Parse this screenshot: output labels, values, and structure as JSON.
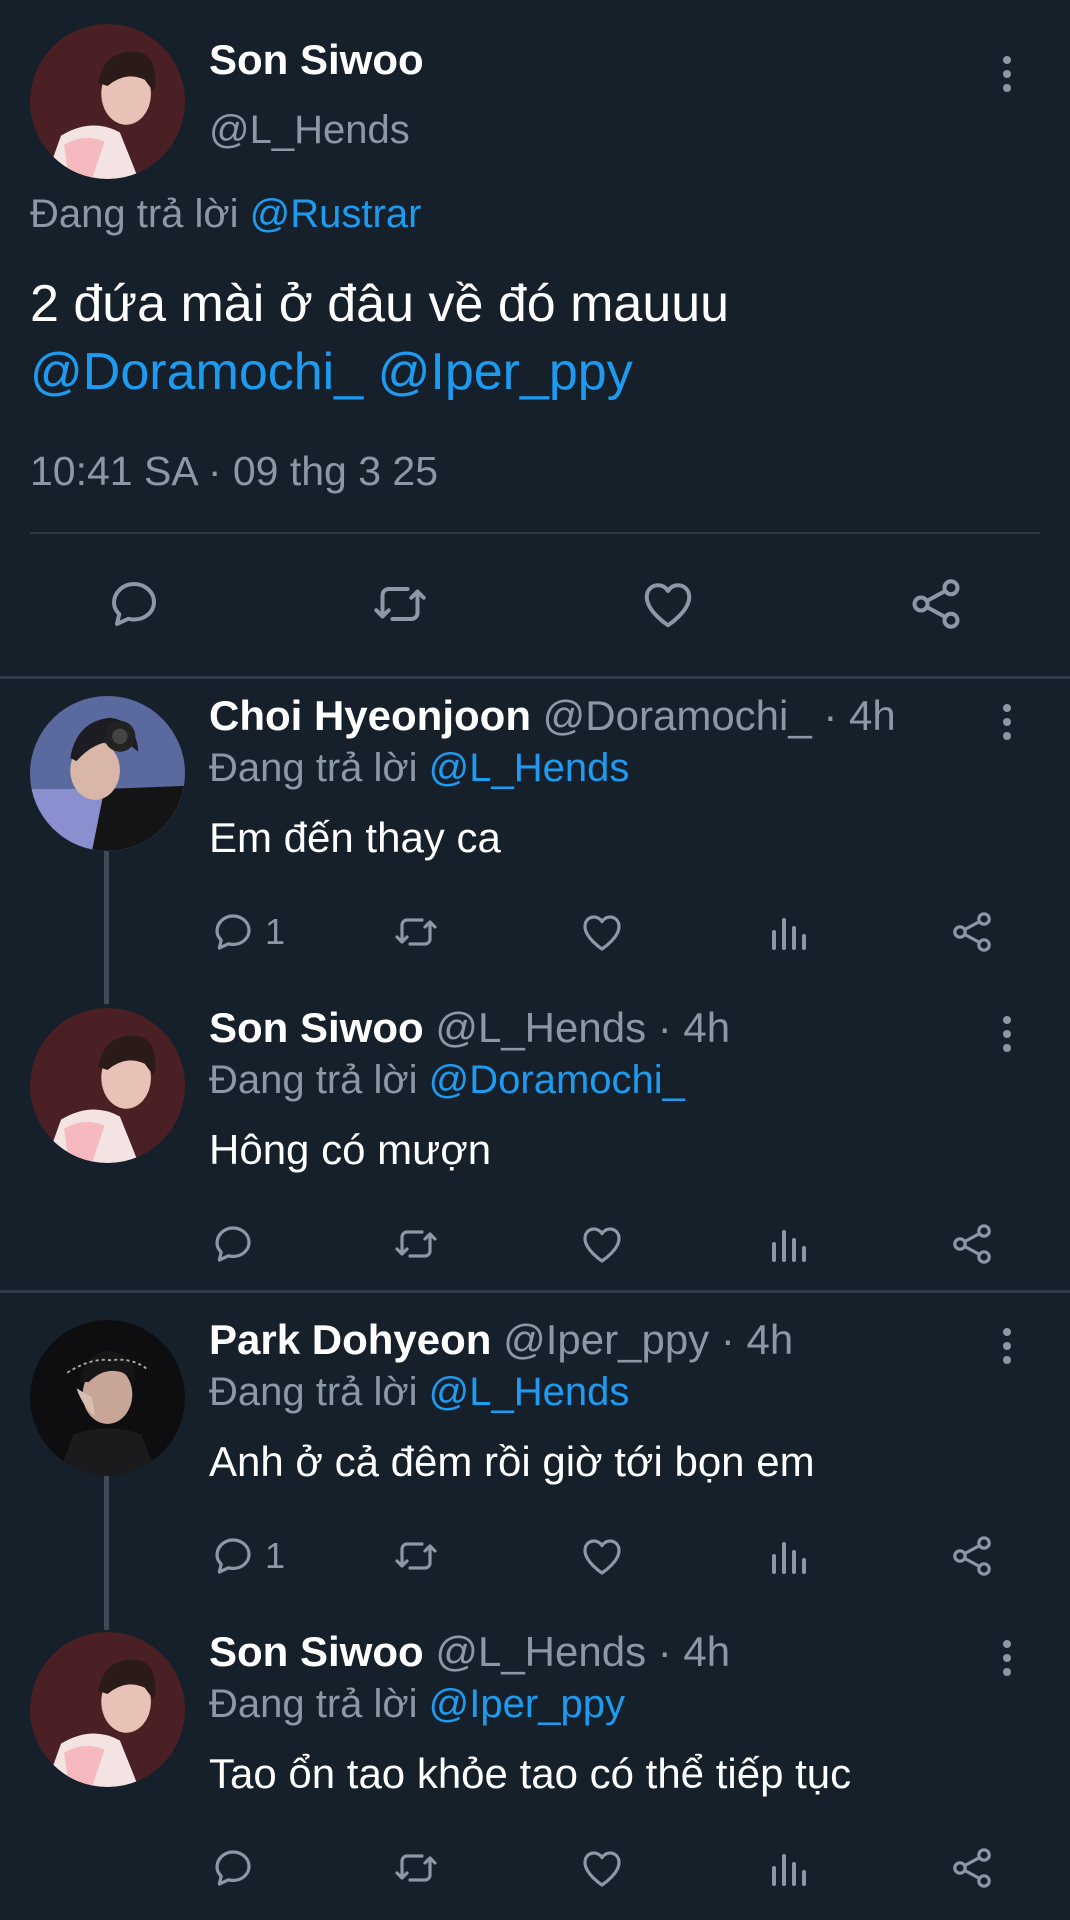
{
  "main_tweet": {
    "author_name": "Son Siwoo",
    "author_handle": "@L_Hends",
    "replying_prefix": "Đang trả lời",
    "replying_to": "@Rustrar",
    "text_line1": "2 đứa mài ở đâu về đó mauuu",
    "mention1": "@Doramochi_",
    "mention2": "@Iper_ppy",
    "timestamp": "10:41 SA · 09 thg 3 25",
    "icons": [
      "reply-icon",
      "retweet-icon",
      "like-icon",
      "share-icon"
    ]
  },
  "replies": [
    {
      "name": "Choi Hyeonjoon",
      "handle_time": "@Doramochi_ · 4h",
      "replying_prefix": "Đang trả lời",
      "replying_to": "@L_Hends",
      "text": "Em đến thay ca",
      "reply_count": "1",
      "avatar": "dark-avatar-headset"
    },
    {
      "name": "Son Siwoo",
      "handle_time": "@L_Hends · 4h",
      "replying_prefix": "Đang trả lời",
      "replying_to": "@Doramochi_",
      "text": "Hông có mượn",
      "reply_count": "",
      "avatar": "red-avatar"
    },
    {
      "name": "Park Dohyeon",
      "handle_time": "@Iper_ppy · 4h",
      "replying_prefix": "Đang trả lời",
      "replying_to": "@L_Hends",
      "text": "Anh ở cả đêm rồi giờ tới bọn em",
      "reply_count": "1",
      "avatar": "dark-avatar"
    },
    {
      "name": "Son Siwoo",
      "handle_time": "@L_Hends · 4h",
      "replying_prefix": "Đang trả lời",
      "replying_to": "@Iper_ppy",
      "text": "Tao ổn tao khỏe tao có thể tiếp tục",
      "reply_count": "",
      "avatar": "red-avatar"
    }
  ],
  "colors": {
    "background": "#16202b",
    "accent": "#1d9bf0",
    "muted": "#8b98a5",
    "divider": "#2f3b47"
  }
}
